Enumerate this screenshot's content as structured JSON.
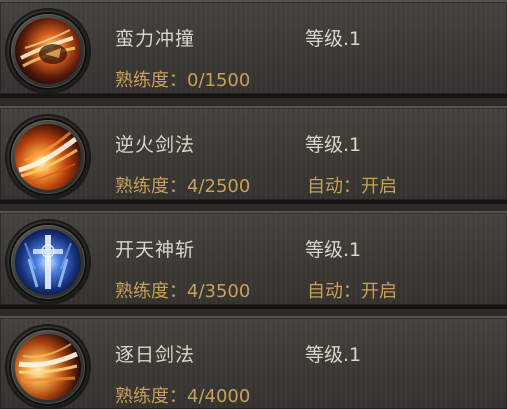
{
  "skills": [
    {
      "name": "蛮力冲撞",
      "level": "等级.1",
      "proficiency": "熟练度：0/1500",
      "auto": "",
      "icon": "charge-icon"
    },
    {
      "name": "逆火剑法",
      "level": "等级.1",
      "proficiency": "熟练度：4/2500",
      "auto": "自动：开启",
      "icon": "fire-sword-icon"
    },
    {
      "name": "开天神斩",
      "level": "等级.1",
      "proficiency": "熟练度：4/3500",
      "auto": "自动：开启",
      "icon": "divine-slash-icon"
    },
    {
      "name": "逐日剑法",
      "level": "等级.1",
      "proficiency": "熟练度：4/4000",
      "auto": "",
      "icon": "sun-chase-sword-icon"
    }
  ]
}
